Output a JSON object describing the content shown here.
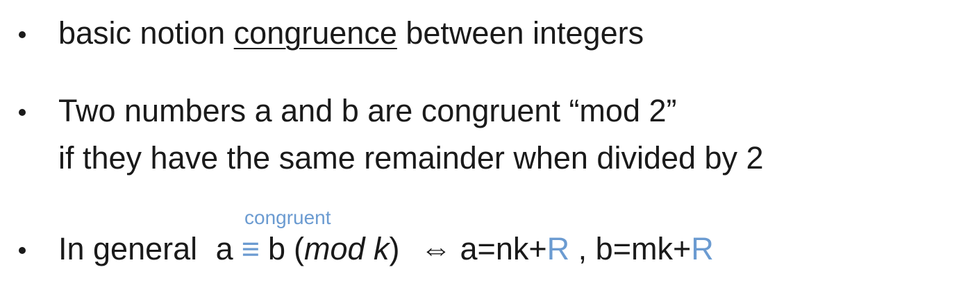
{
  "bullets": [
    {
      "pre": "basic notion ",
      "term": "congruence",
      "post": " between integers"
    },
    {
      "line1": "Two numbers a and b are congruent “mod 2”",
      "line2": "if they have the same remainder when divided by 2"
    },
    {
      "lead": "In general ",
      "a": "a",
      "equiv": "≡",
      "b": "b",
      "mod_open": "(",
      "mod_text": "mod k",
      "mod_close": ")",
      "iff": "⇔",
      "eq1": "a=nk+",
      "r1": "R",
      "sep": " , b=mk+",
      "r2": "R",
      "annotation": "congruent"
    }
  ],
  "colors": {
    "text": "#1a1a1a",
    "accent": "#6b9bd1"
  }
}
